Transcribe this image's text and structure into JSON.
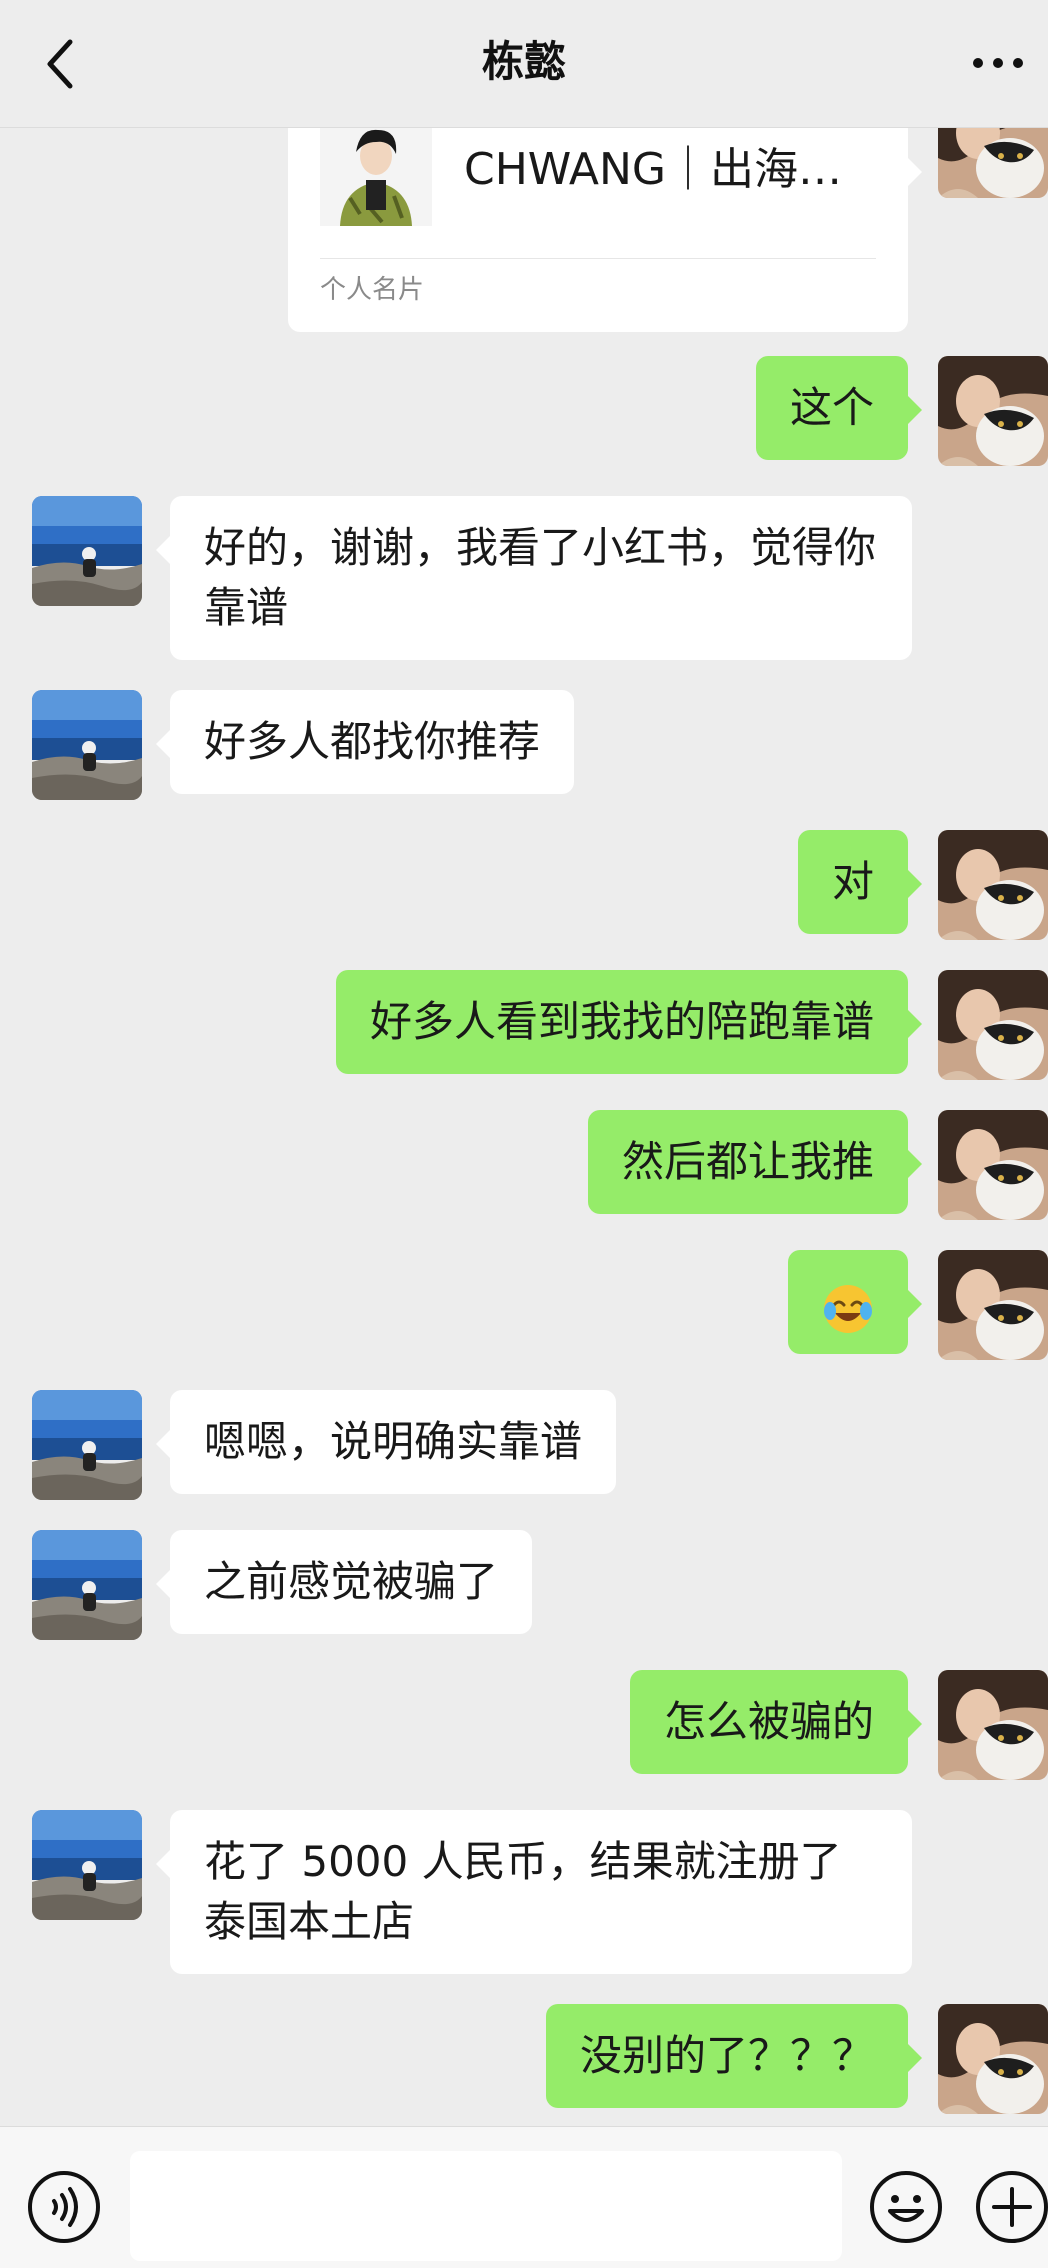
{
  "header": {
    "title": "栋懿"
  },
  "contact_card": {
    "name": "CHWANG｜出海…",
    "label": "个人名片"
  },
  "messages": [
    {
      "side": "out",
      "text": "这个"
    },
    {
      "side": "in",
      "text": "好的，谢谢，我看了小红书，觉得你靠谱"
    },
    {
      "side": "in",
      "text": "好多人都找你推荐"
    },
    {
      "side": "out",
      "text": "对"
    },
    {
      "side": "out",
      "text": "好多人看到我找的陪跑靠谱"
    },
    {
      "side": "out",
      "text": "然后都让我推"
    },
    {
      "side": "out",
      "emoji": "laughing-crying-face"
    },
    {
      "side": "in",
      "text": "嗯嗯，说明确实靠谱"
    },
    {
      "side": "in",
      "text": "之前感觉被骗了"
    },
    {
      "side": "out",
      "text": "怎么被骗的"
    },
    {
      "side": "in",
      "text": "花了 5000 人民币，结果就注册了泰国本土店"
    },
    {
      "side": "out",
      "text": "没别的了？？？"
    }
  ],
  "colors": {
    "background": "#ededed",
    "outgoing_bubble": "#95ec69",
    "incoming_bubble": "#ffffff"
  },
  "footer": {
    "input_value": ""
  }
}
